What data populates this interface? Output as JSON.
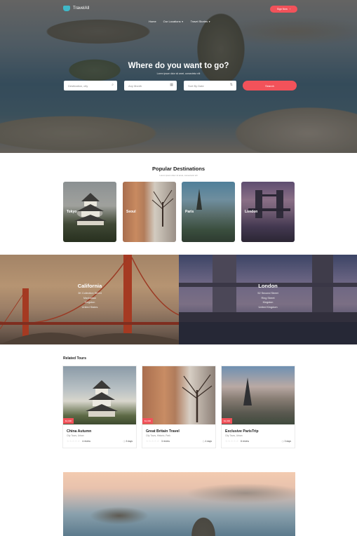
{
  "header": {
    "logo_text": "TravelAll",
    "nav": [
      {
        "label": "Home",
        "caret": false
      },
      {
        "label": "Our Locations",
        "caret": true
      },
      {
        "label": "Travel Stories",
        "caret": true
      }
    ],
    "signup_label": "Sign Now",
    "signup_icon": "chevron-right-icon"
  },
  "hero": {
    "title": "Where do you want to go?",
    "subtitle": "Lorem ipsum dolor sit amet, consectetur elit",
    "search": {
      "destination_placeholder": "Destination, city",
      "month_placeholder": "Any Month",
      "sort_placeholder": "Sort By Date",
      "button_label": "Search"
    }
  },
  "popular": {
    "title": "Popular Destinations",
    "subtitle": "Lorem ipsum dolor sit amet, consectetur elit",
    "cards": [
      {
        "label": "Tokyo"
      },
      {
        "label": "Seoul"
      },
      {
        "label": "Paris"
      },
      {
        "label": "London"
      }
    ]
  },
  "banners": [
    {
      "title": "California",
      "lines": [
        "3K Collection Street",
        "Manhattan",
        "Kingston",
        "United States"
      ]
    },
    {
      "title": "London",
      "lines": [
        "52 Second Street",
        "Ring Street",
        "Kingston",
        "United Kingdom"
      ]
    }
  ],
  "related": {
    "title": "Related Tours",
    "tours": [
      {
        "price": "$1,000",
        "name": "China Autumn",
        "category": "City Tours, Urban",
        "stars": "☆☆☆☆☆",
        "reviews": "4 review",
        "days": "5 days"
      },
      {
        "price": "$1,000",
        "name": "Great Britain Travel",
        "category": "City Tours, Historic, Park",
        "stars": "☆☆☆☆☆",
        "reviews": "3 review",
        "days": "4 days"
      },
      {
        "price": "$1,000",
        "name": "Exclusive ParisTrip",
        "category": "City Tours, Urban",
        "stars": "☆☆☆☆☆",
        "reviews": "8 review",
        "days": "3 days"
      }
    ]
  },
  "colors": {
    "accent": "#f2525a",
    "logo": "#3fb8c8"
  }
}
